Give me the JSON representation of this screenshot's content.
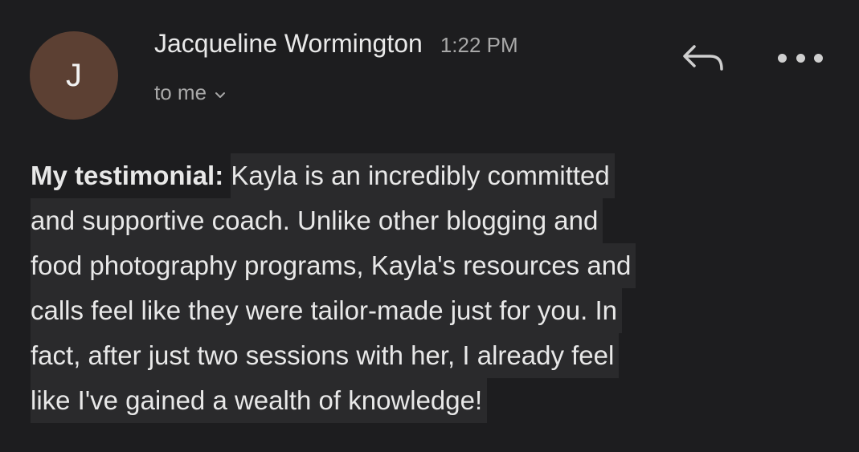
{
  "email": {
    "avatar_initial": "J",
    "sender_name": "Jacqueline Wormington",
    "time": "1:22 PM",
    "recipient": "to me",
    "body": {
      "label": "My testimonial:",
      "lines": [
        "Kayla is an incredibly committed",
        "and supportive coach. Unlike other blogging and",
        "food photography programs, Kayla's resources and",
        "calls feel like they were tailor-made just for you. In",
        "fact, after just two sessions with her, I already feel",
        "like I've gained a wealth of knowledge!"
      ]
    }
  },
  "colors": {
    "background": "#1d1d1f",
    "avatar": "#5c4033",
    "text_highlight": "#2a2a2c"
  },
  "icons": {
    "reply": "reply-arrow-icon",
    "more": "more-horizontal-icon",
    "chevron": "chevron-down-icon"
  }
}
